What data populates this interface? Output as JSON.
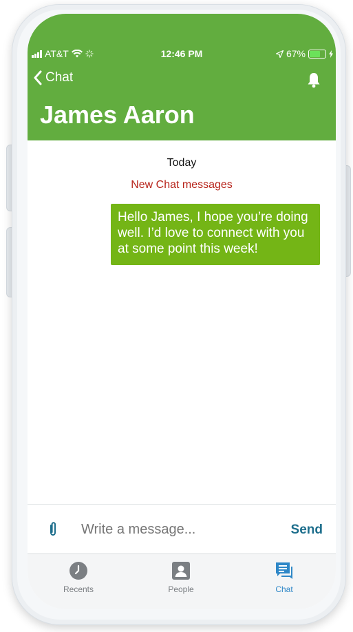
{
  "status_bar": {
    "carrier": "AT&T",
    "time": "12:46 PM",
    "battery_percent": "67%",
    "battery_level": 0.67
  },
  "nav": {
    "back_label": "Chat"
  },
  "header": {
    "title": "James Aaron"
  },
  "conversation": {
    "day_label": "Today",
    "new_messages_label": "New Chat messages",
    "messages": [
      {
        "text": "Hello James, I hope you’re doing well.  I’d love to connect with you at some point this week!",
        "outgoing": true
      }
    ]
  },
  "composer": {
    "placeholder": "Write a message...",
    "send_label": "Send"
  },
  "tabs": [
    {
      "label": "Recents",
      "icon": "clock-icon",
      "active": false
    },
    {
      "label": "People",
      "icon": "person-icon",
      "active": false
    },
    {
      "label": "Chat",
      "icon": "chat-icon",
      "active": true
    }
  ],
  "colors": {
    "header_green": "#62ad3f",
    "bubble_green": "#74b516",
    "new_messages_red": "#b7231a",
    "send_blue": "#1d6e8c",
    "active_tab_blue": "#2e87c7"
  }
}
